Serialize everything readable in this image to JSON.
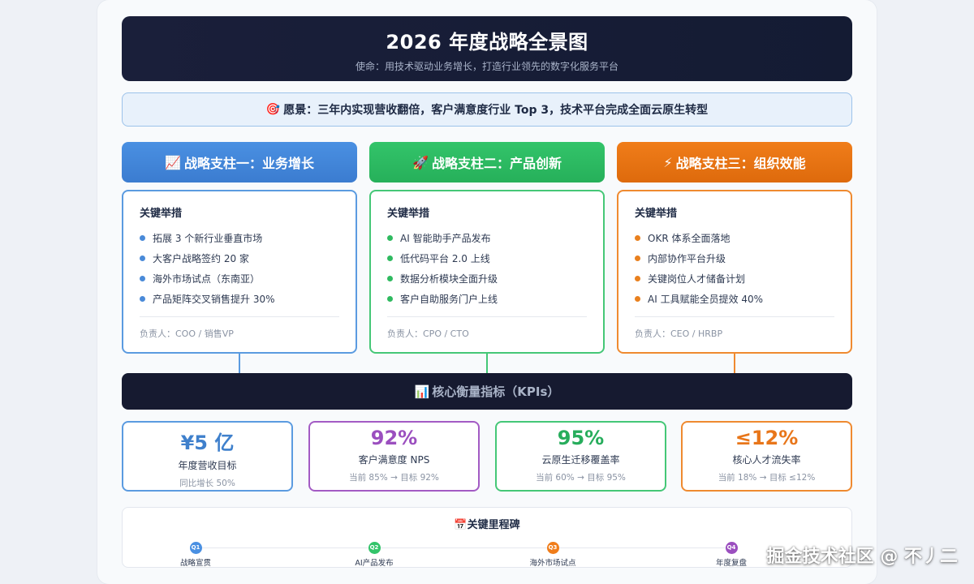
{
  "header": {
    "title": "2026 年度战略全景图",
    "mission": "使命：用技术驱动业务增长，打造行业领先的数字化服务平台"
  },
  "vision": {
    "icon": "🎯",
    "text": "愿景：三年内实现营收翻倍，客户满意度行业 Top 3，技术平台完成全面云原生转型"
  },
  "pillars": [
    {
      "icon": "📈",
      "title": "战略支柱一：业务增长",
      "color": "#4a90e2",
      "section_label": "关键举措",
      "items": [
        "拓展 3 个新行业垂直市场",
        "大客户战略签约 20 家",
        "海外市场试点（东南亚）",
        "产品矩阵交叉销售提升 30%"
      ],
      "owner": "负责人：COO / 销售VP"
    },
    {
      "icon": "🚀",
      "title": "战略支柱二：产品创新",
      "color": "#33c46a",
      "section_label": "关键举措",
      "items": [
        "AI 智能助手产品发布",
        "低代码平台 2.0 上线",
        "数据分析模块全面升级",
        "客户自助服务门户上线"
      ],
      "owner": "负责人：CPO / CTO"
    },
    {
      "icon": "⚡",
      "title": "战略支柱三：组织效能",
      "color": "#f07d1a",
      "section_label": "关键举措",
      "items": [
        "OKR 体系全面落地",
        "内部协作平台升级",
        "关键岗位人才储备计划",
        "AI 工具赋能全员提效 40%"
      ],
      "owner": "负责人：CEO / HRBP"
    }
  ],
  "kpi_section": {
    "icon": "📊",
    "title": "核心衡量指标（KPIs）"
  },
  "kpis": [
    {
      "value": "¥5 亿",
      "label": "年度营收目标",
      "sub": "同比增长 50%",
      "color": "#3f80cc"
    },
    {
      "value": "92%",
      "label": "客户满意度 NPS",
      "sub": "当前 85% → 目标 92%",
      "color": "#9b4fbf"
    },
    {
      "value": "95%",
      "label": "云原生迁移覆盖率",
      "sub": "当前 60% → 目标 95%",
      "color": "#27ad5c"
    },
    {
      "value": "≤12%",
      "label": "核心人才流失率",
      "sub": "当前 18% → 目标 ≤12%",
      "color": "#e8761a"
    }
  ],
  "milestones": {
    "icon": "📅",
    "title": "关键里程碑",
    "items": [
      {
        "badge": "Q1",
        "label": "战略宣贯",
        "color": "#4a90e2"
      },
      {
        "badge": "Q2",
        "label": "AI产品发布",
        "color": "#33c46a"
      },
      {
        "badge": "Q3",
        "label": "海外市场试点",
        "color": "#f07d1a"
      },
      {
        "badge": "Q4",
        "label": "年度复盘",
        "color": "#9b4fbf"
      }
    ]
  },
  "watermark": "掘金技术社区 @ 不丿二"
}
